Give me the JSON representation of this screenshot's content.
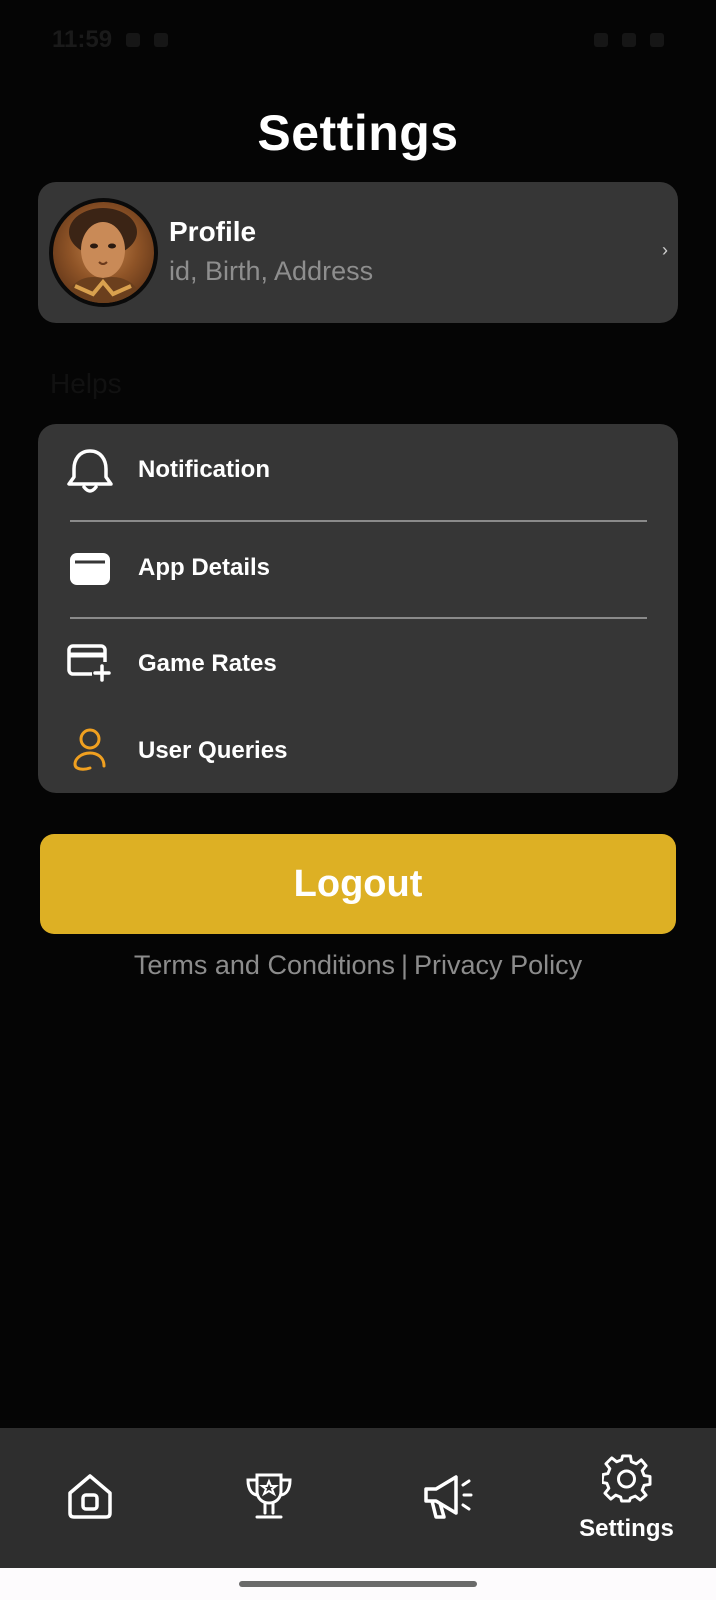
{
  "status_bar": {
    "time": "11:59"
  },
  "page_title": "Settings",
  "profile": {
    "name": "Profile",
    "subtitle": "id, Birth, Address",
    "chevron": "›"
  },
  "helps": {
    "section_label": "Helps",
    "items": [
      {
        "label": "Notification",
        "icon": "bell-icon"
      },
      {
        "label": "App Details",
        "icon": "wallet-icon"
      },
      {
        "label": "Game Rates",
        "icon": "card-add-icon"
      },
      {
        "label": "User Queries",
        "icon": "user-icon"
      }
    ]
  },
  "logout_label": "Logout",
  "legal": {
    "terms": "Terms and Conditions",
    "separator": "|",
    "privacy": "Privacy Policy"
  },
  "bottom_nav": {
    "items": [
      {
        "icon": "home-icon",
        "label": ""
      },
      {
        "icon": "trophy-icon",
        "label": ""
      },
      {
        "icon": "megaphone-icon",
        "label": ""
      },
      {
        "icon": "gear-icon",
        "label": "Settings",
        "active": true
      }
    ]
  },
  "colors": {
    "background": "#050505",
    "card": "#363636",
    "accent": "#ddb024",
    "user_icon": "#f0a020",
    "muted_text": "#8c8c8c"
  }
}
